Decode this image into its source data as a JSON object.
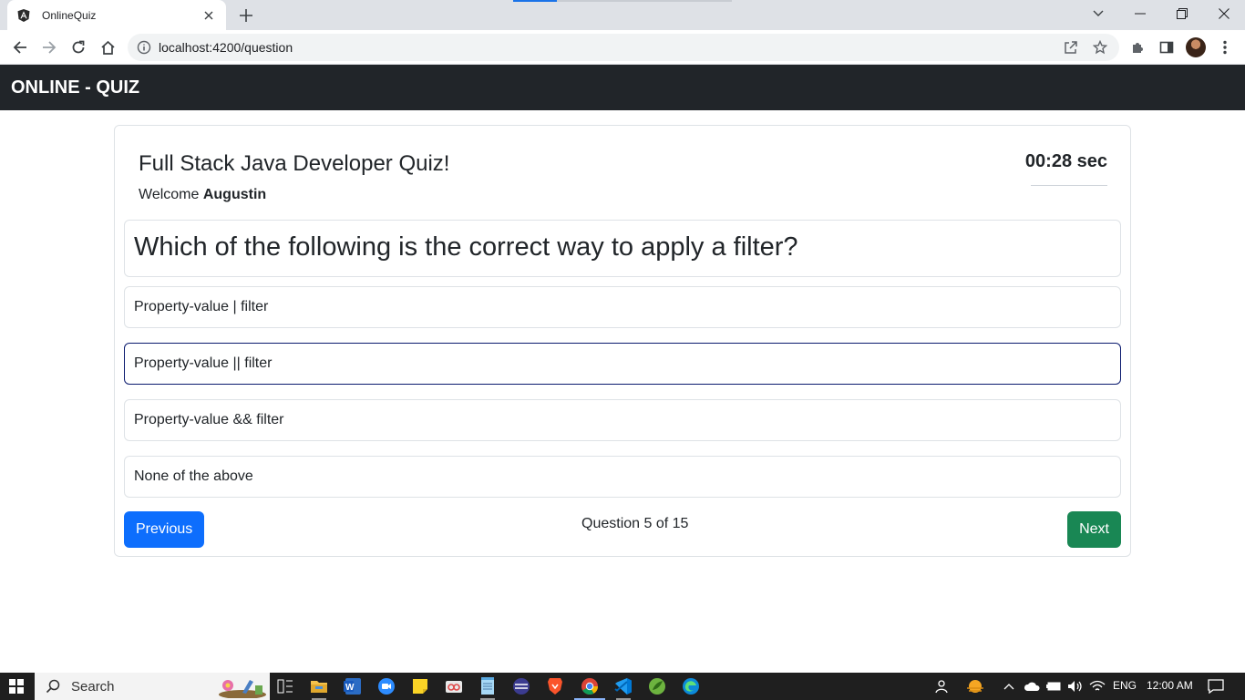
{
  "browser": {
    "tab_title": "OnlineQuiz",
    "url": "localhost:4200/question",
    "icons": [
      "angular-favicon-icon",
      "close-tab-icon",
      "new-tab-icon",
      "tab-search-icon",
      "minimize-icon",
      "restore-icon",
      "window-close-icon",
      "back-icon",
      "forward-icon",
      "reload-icon",
      "home-icon",
      "site-info-icon",
      "share-icon",
      "bookmark-star-icon",
      "extensions-icon",
      "side-panel-icon",
      "profile-avatar",
      "menu-dots-icon"
    ]
  },
  "navbar": {
    "brand": "ONLINE - QUIZ",
    "background": "#212529"
  },
  "quiz": {
    "title": "Full Stack Java Developer Quiz!",
    "welcome_prefix": "Welcome",
    "user_name": "Augustin",
    "timer": "00:28 sec",
    "question": "Which of the following is the correct way to apply a filter?",
    "options": [
      "Property-value | filter",
      "Property-value || filter",
      "Property-value && filter",
      "None of the above"
    ],
    "selected_option_index": 1,
    "previous_label": "Previous",
    "next_label": "Next",
    "progress_text": "Question 5 of 15",
    "colors": {
      "previous_button": "#0d6efd",
      "next_button": "#198754",
      "selected_border": "#0a1a6e"
    }
  },
  "taskbar": {
    "search_placeholder": "Search",
    "apps": [
      "task-view-icon",
      "file-explorer-icon",
      "word-icon",
      "zoom-icon",
      "sticky-notes-icon",
      "snipping-tool-icon",
      "notepad-icon",
      "app-icon",
      "brave-icon",
      "chrome-icon",
      "vscode-icon",
      "spring-tool-icon",
      "edge-icon"
    ],
    "language": "ENG",
    "time": "12:00 AM"
  }
}
